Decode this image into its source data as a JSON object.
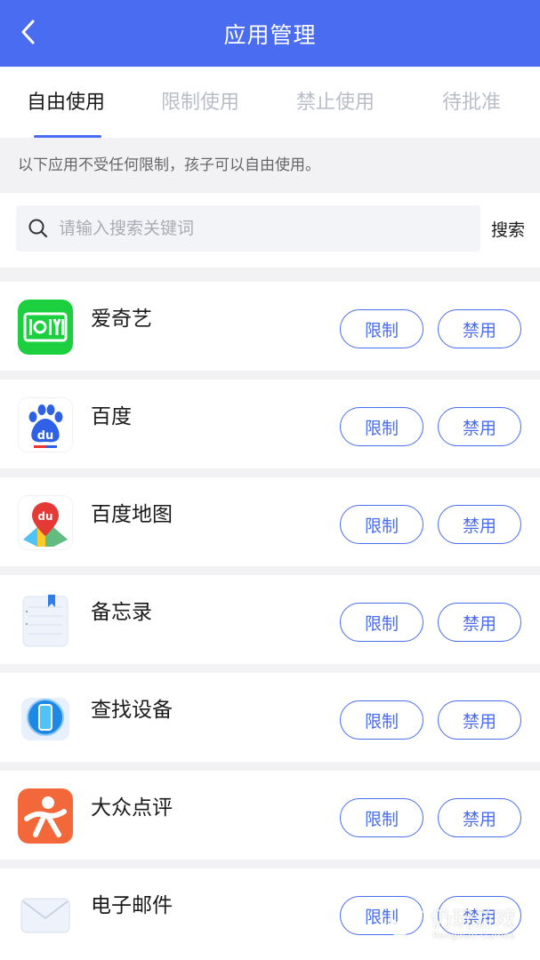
{
  "header": {
    "title": "应用管理",
    "back_icon": "chevron-left-icon"
  },
  "tabs": [
    {
      "label": "自由使用",
      "active": true
    },
    {
      "label": "限制使用",
      "active": false
    },
    {
      "label": "禁止使用",
      "active": false
    },
    {
      "label": "待批准",
      "active": false
    }
  ],
  "notice": "以下应用不受任何限制，孩子可以自由使用。",
  "search": {
    "placeholder": "请输入搜索关键词",
    "button_label": "搜索",
    "icon": "search-icon"
  },
  "apps": [
    {
      "name": "爱奇艺",
      "icon": "iqiyi-icon",
      "limit_label": "限制",
      "ban_label": "禁用"
    },
    {
      "name": "百度",
      "icon": "baidu-icon",
      "limit_label": "限制",
      "ban_label": "禁用"
    },
    {
      "name": "百度地图",
      "icon": "baidu-map-icon",
      "limit_label": "限制",
      "ban_label": "禁用"
    },
    {
      "name": "备忘录",
      "icon": "notes-icon",
      "limit_label": "限制",
      "ban_label": "禁用"
    },
    {
      "name": "查找设备",
      "icon": "find-device-icon",
      "limit_label": "限制",
      "ban_label": "禁用"
    },
    {
      "name": "大众点评",
      "icon": "dianping-icon",
      "limit_label": "限制",
      "ban_label": "禁用"
    },
    {
      "name": "电子邮件",
      "icon": "email-icon",
      "limit_label": "限制",
      "ban_label": "禁用"
    }
  ],
  "watermark": {
    "text": "仍玩游戏",
    "sub": "Rengwan Games"
  },
  "colors": {
    "accent": "#4a6cf0",
    "background": "#f2f2f4"
  }
}
